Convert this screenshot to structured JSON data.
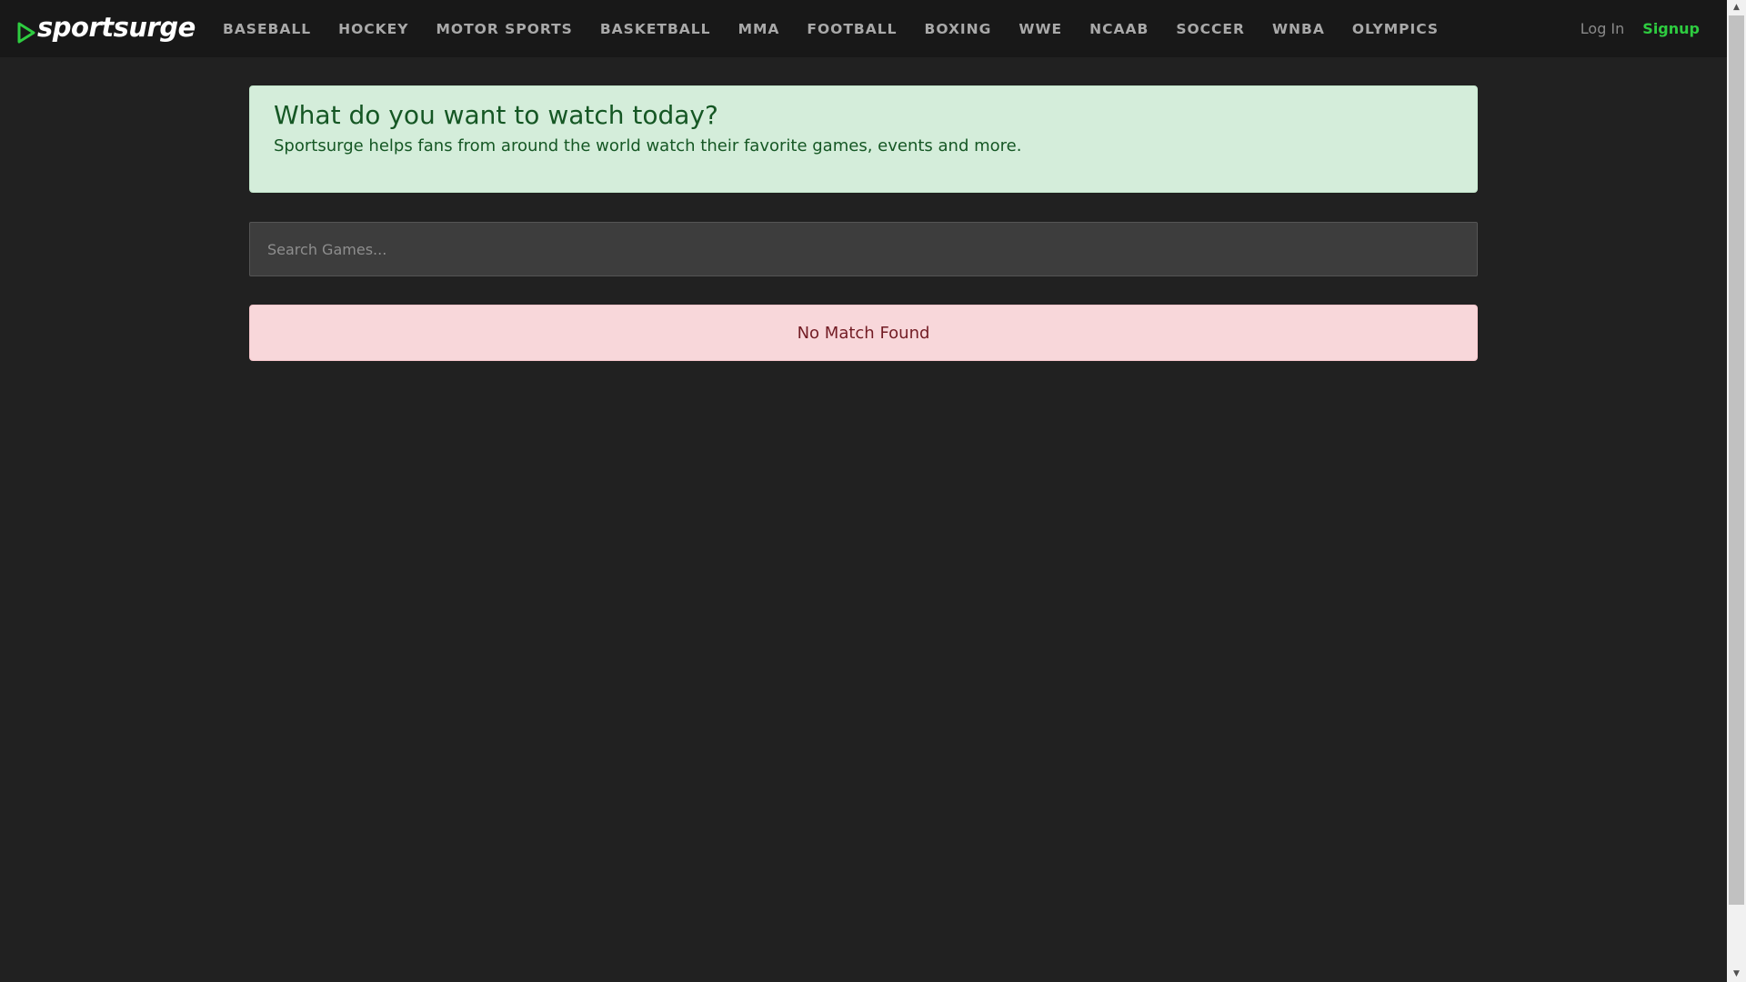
{
  "brand": {
    "name": "sportsurge",
    "play_icon": "play-triangle-icon",
    "accent_color": "#2ecc40"
  },
  "nav": {
    "items": [
      {
        "label": "BASEBALL"
      },
      {
        "label": "HOCKEY"
      },
      {
        "label": "MOTOR SPORTS"
      },
      {
        "label": "BASKETBALL"
      },
      {
        "label": "MMA"
      },
      {
        "label": "FOOTBALL"
      },
      {
        "label": "BOXING"
      },
      {
        "label": "WWE"
      },
      {
        "label": "NCAAB"
      },
      {
        "label": "SOCCER"
      },
      {
        "label": "WNBA"
      },
      {
        "label": "OLYMPICS"
      }
    ]
  },
  "auth": {
    "login_label": "Log In",
    "signup_label": "Signup"
  },
  "hero": {
    "title": "What do you want to watch today?",
    "subtitle": "Sportsurge helps fans from around the world watch their favorite games, events and more."
  },
  "search": {
    "placeholder": "Search Games...",
    "value": ""
  },
  "results": {
    "empty_message": "No Match Found"
  },
  "colors": {
    "page_background": "#212121",
    "navbar_background": "#181818",
    "hero_background": "#d4edda",
    "hero_text": "#155724",
    "alert_background": "#f8d7da",
    "alert_text": "#721c24"
  }
}
